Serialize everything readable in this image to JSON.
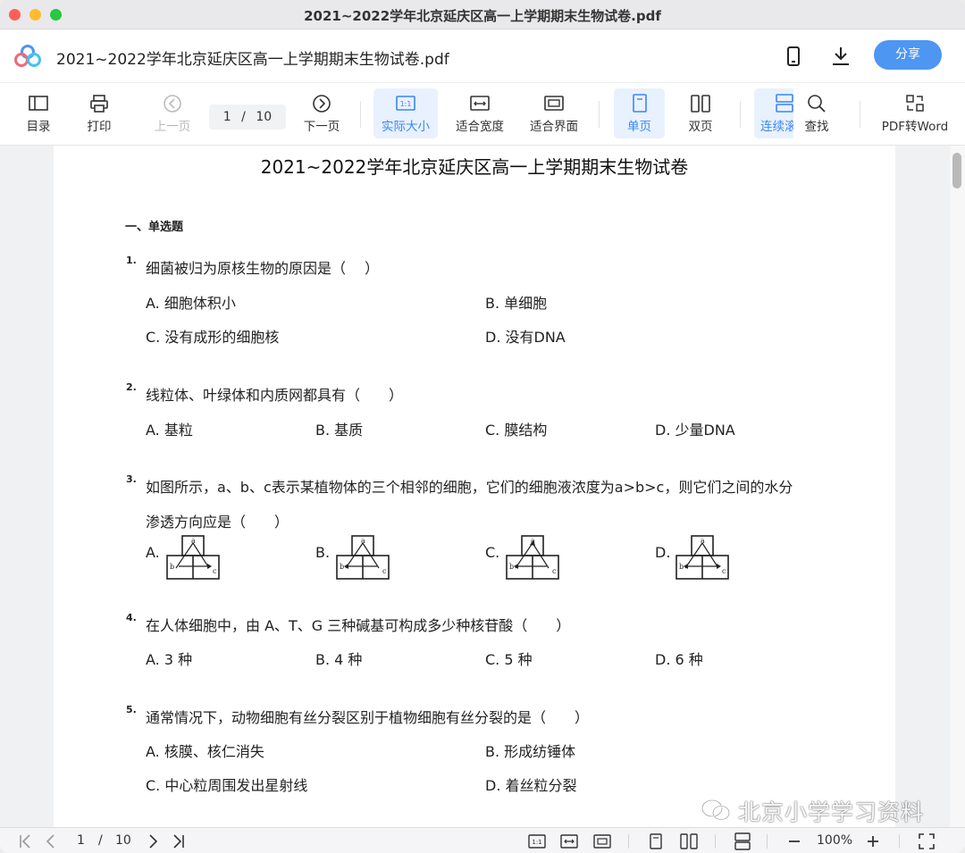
{
  "window": {
    "title": "2021~2022学年北京延庆区高一上学期期末生物试卷.pdf"
  },
  "header": {
    "doc_title": "2021~2022学年北京延庆区高一上学期期末生物试卷.pdf",
    "share_label": "分享"
  },
  "toolbar": {
    "toc": "目录",
    "print": "打印",
    "prev": "上一页",
    "page_current": "1",
    "page_sep": "/",
    "page_total": "10",
    "next": "下一页",
    "actual_size": "实际大小",
    "fit_width": "适合宽度",
    "fit_window": "适合界面",
    "single": "单页",
    "double": "双页",
    "continuous": "连续滚",
    "find": "查找",
    "pdf_to_word": "PDF转Word"
  },
  "document": {
    "title": "2021~2022学年北京延庆区高一上学期期末生物试卷",
    "section": "一、单选题",
    "questions": [
      {
        "num": "1.",
        "lines": [
          "细菌被归为原核生物的原因是（　 ）"
        ],
        "options": [
          "A. 细胞体积小",
          "B. 单细胞",
          "C. 没有成形的细胞核",
          "D. 没有DNA"
        ]
      },
      {
        "num": "2.",
        "lines": [
          "线粒体、叶绿体和内质网都具有（　　）"
        ],
        "options": [
          "A. 基粒",
          "B. 基质",
          "C. 膜结构",
          "D. 少量DNA"
        ]
      },
      {
        "num": "3.",
        "lines": [
          "如图所示，a、b、c表示某植物体的三个相邻的细胞，它们的细胞液浓度为a>b>c，则它们之间的水分",
          "渗透方向应是（　　）"
        ],
        "options": [
          "A.",
          "B.",
          "C.",
          "D."
        ]
      },
      {
        "num": "4.",
        "lines": [
          "在人体细胞中，由 A、T、G 三种碱基可构成多少种核苷酸（　　）"
        ],
        "options": [
          "A. 3 种",
          "B. 4 种",
          "C. 5 种",
          "D. 6 种"
        ]
      },
      {
        "num": "5.",
        "lines": [
          "通常情况下，动物细胞有丝分裂区别于植物细胞有丝分裂的是（　　）"
        ],
        "options": [
          "A. 核膜、核仁消失",
          "B. 形成纺锤体",
          "C. 中心粒周围发出星射线",
          "D. 着丝粒分裂"
        ]
      }
    ],
    "diagram_labels": {
      "a": "a",
      "b": "b",
      "c": "c"
    }
  },
  "watermark": "北京小学学习资料",
  "statusbar": {
    "page_current": "1",
    "page_sep": "/",
    "page_total": "10",
    "zoom": "100%"
  },
  "colors": {
    "accent": "#4d96f2",
    "active_bg": "#e8f1fe"
  }
}
